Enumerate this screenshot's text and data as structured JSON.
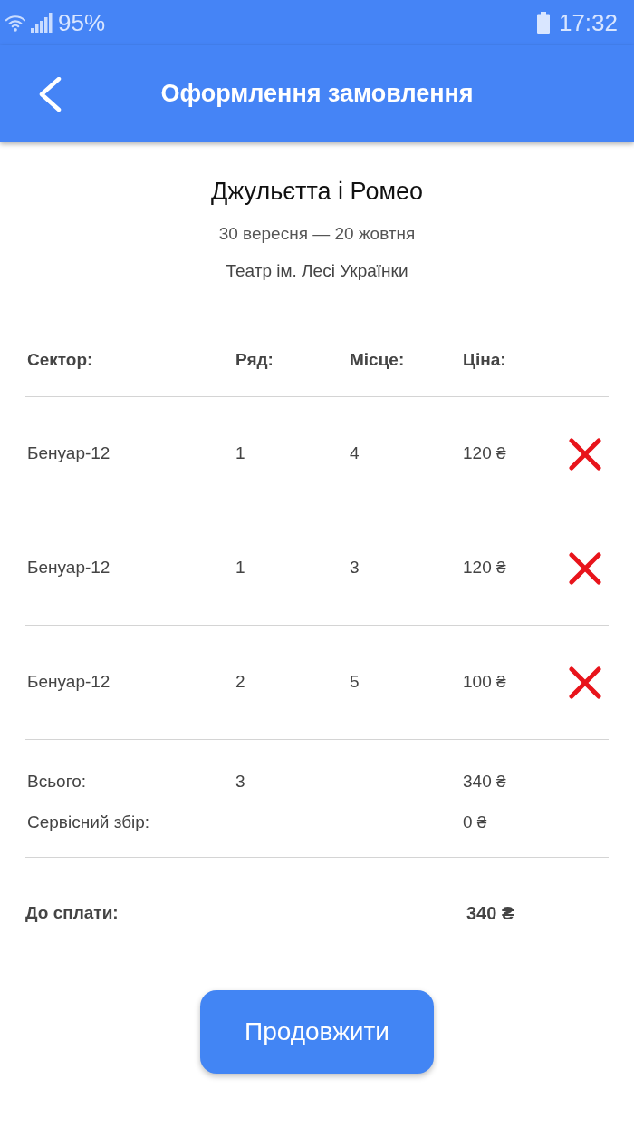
{
  "status_bar": {
    "battery_percent": "95%",
    "time": "17:32"
  },
  "header": {
    "title": "Оформлення замовлення"
  },
  "event": {
    "title": "Джульєтта і Ромео",
    "dates": "30 вересня — 20 жовтня",
    "venue": "Театр ім. Лесі Українки"
  },
  "table": {
    "columns": [
      "Сектор:",
      "Ряд:",
      "Місце:",
      "Ціна:"
    ],
    "rows": [
      {
        "sector": "Бенуар-12",
        "row": "1",
        "seat": "4",
        "price": "120 ₴"
      },
      {
        "sector": "Бенуар-12",
        "row": "1",
        "seat": "3",
        "price": "120 ₴"
      },
      {
        "sector": "Бенуар-12",
        "row": "2",
        "seat": "5",
        "price": "100 ₴"
      }
    ]
  },
  "summary": [
    {
      "label": "Всього:",
      "count": "3",
      "value": "340 ₴"
    },
    {
      "label": "Сервісний збір:",
      "value": "0 ₴"
    }
  ],
  "total": {
    "label": "До сплати:",
    "value": "340 ₴"
  },
  "button": {
    "label": "Продовжити"
  }
}
